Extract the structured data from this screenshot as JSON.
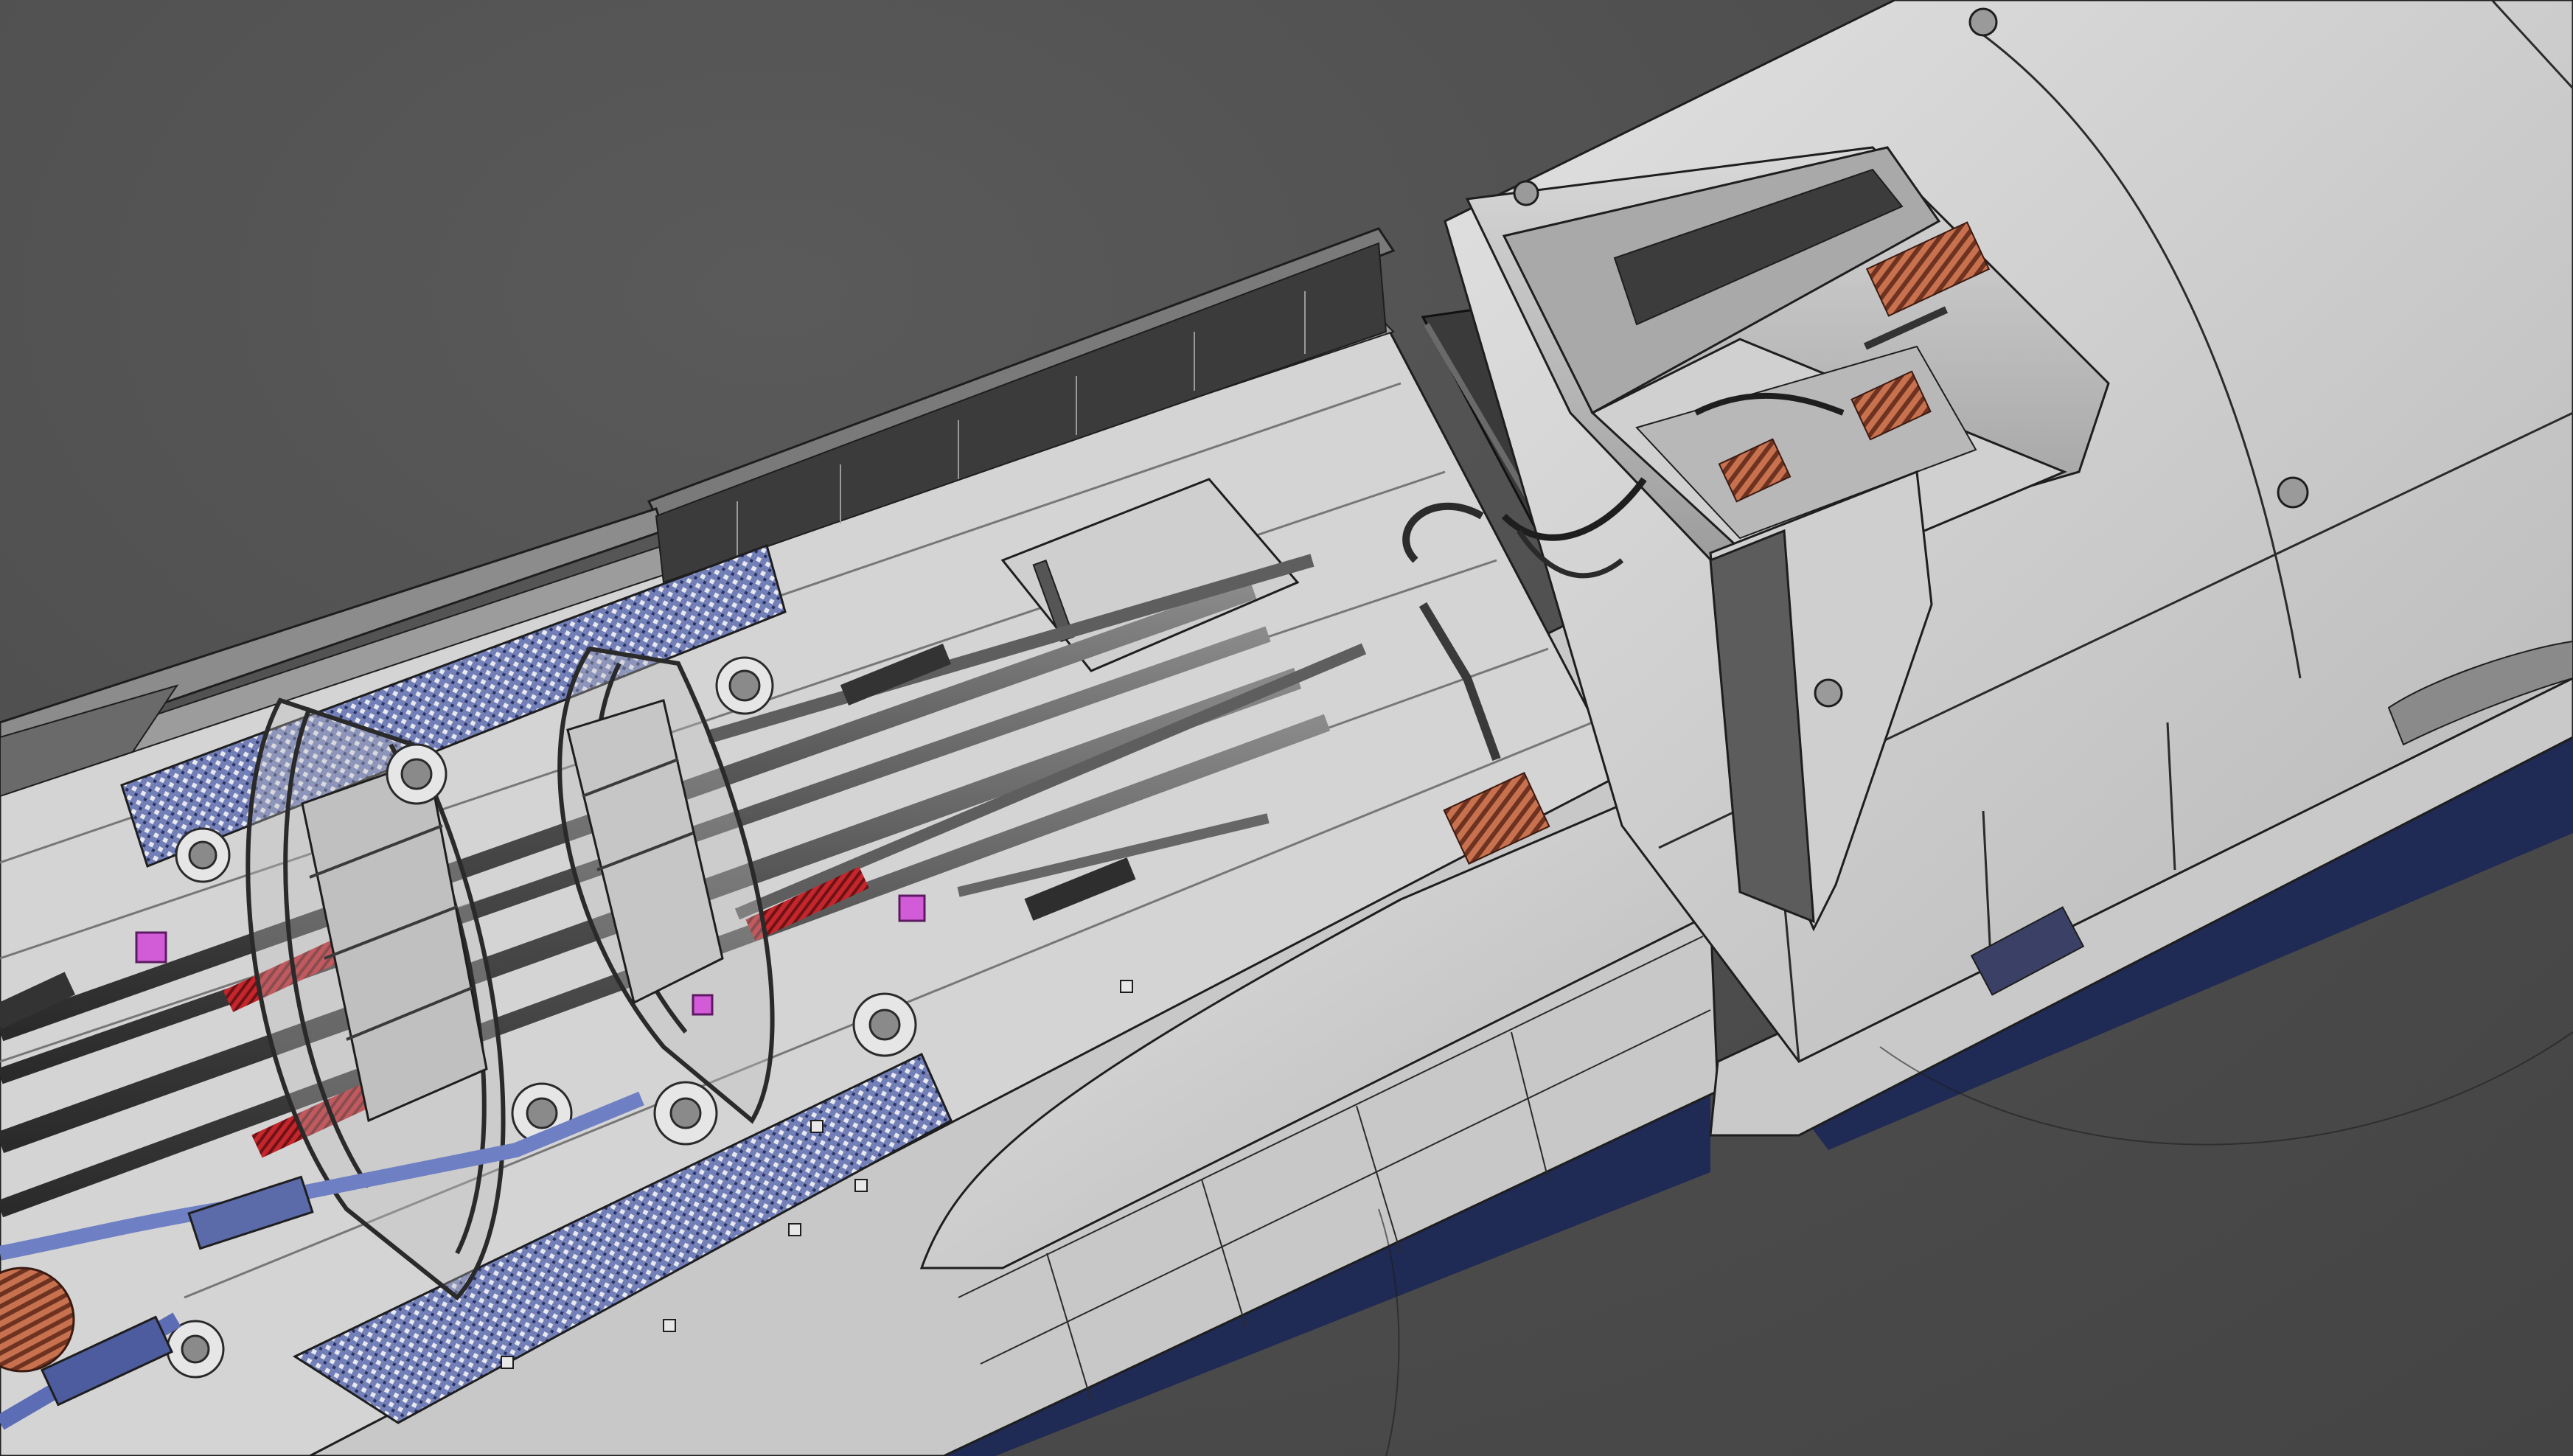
{
  "app": {
    "window_title": ""
  },
  "viewport": {
    "background_color": "#4d4d4d",
    "render_style": "shaded-with-edges",
    "content": "3d-model-roof-equipment"
  },
  "colors": {
    "body_light": "#d8d8d8",
    "body_mid": "#b4b4b4",
    "body_dark": "#6a6a6a",
    "edge_line": "#1e1e1e",
    "stripe_navy": "#1f2a55",
    "walkway_blue": "#5b6aa8",
    "insulator_copper": "#b0583a",
    "spring_red": "#c4262b",
    "bracket_magenta": "#d25bd8",
    "pipe_blue": "#6e7fc4"
  },
  "icons": [
    "roof-panel-icon",
    "insulator-icon",
    "pantograph-frame-icon",
    "air-spring-icon",
    "grating-walkway-icon"
  ]
}
